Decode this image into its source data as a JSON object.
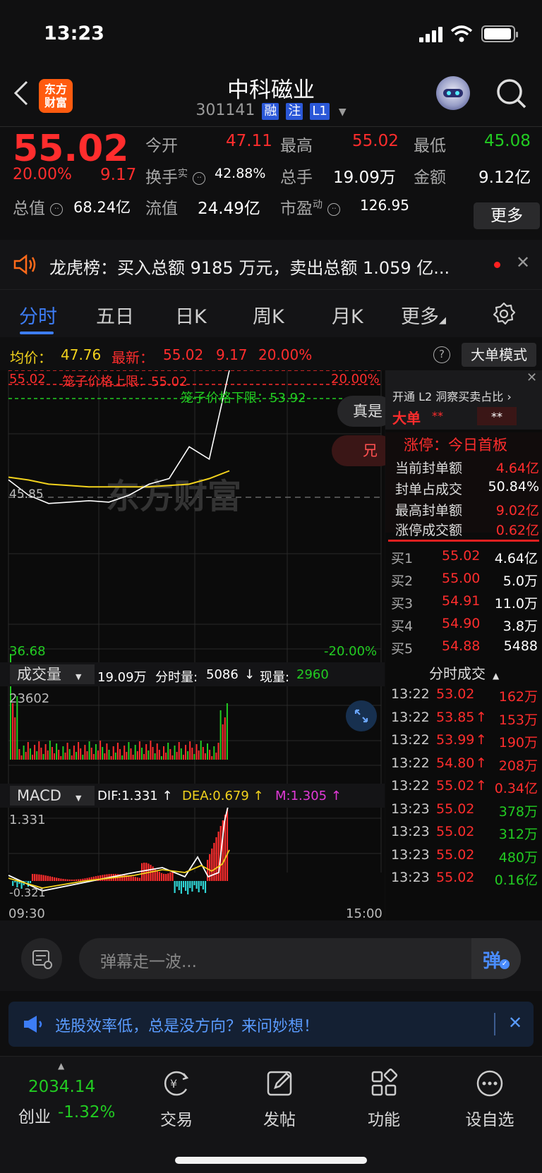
{
  "status_bar": {
    "time": "13:23"
  },
  "header": {
    "stock_name": "中科磁业",
    "stock_code": "301141",
    "tags": [
      "融",
      "注",
      "L1"
    ],
    "logo_text_line1": "东方",
    "logo_text_line2": "财富"
  },
  "quote": {
    "price": "55.02",
    "change_pct": "20.00%",
    "change": "9.17",
    "open_label": "今开",
    "open": "47.11",
    "high_label": "最高",
    "high": "55.02",
    "low_label": "最低",
    "low": "45.08",
    "turnover_label": "换手",
    "turnover_sup": "实",
    "turnover": "42.88%",
    "volume_label": "总手",
    "volume": "19.09万",
    "amount_label": "金额",
    "amount": "9.12亿",
    "mktcap_label": "总值",
    "mktcap": "68.24亿",
    "float_label": "流值",
    "float": "24.49亿",
    "pe_label": "市盈",
    "pe_sup": "动",
    "pe": "126.95",
    "more_label": "更多"
  },
  "dragon": {
    "text": "龙虎榜：买入总额 9185 万元，卖出总额 1.059 亿..."
  },
  "tabs": [
    "分时",
    "五日",
    "日K",
    "周K",
    "月K",
    "更多"
  ],
  "info_line": {
    "avg_label": "均价：",
    "avg": "47.76",
    "latest_label": "最新：",
    "latest": "55.02",
    "latest_change": "9.17",
    "latest_pct": "20.00%",
    "mode_label": "大单模式"
  },
  "chart": {
    "top_price": "55.02",
    "top_pct": "20.00%",
    "bottom_price": "36.68",
    "bottom_pct": "-20.00%",
    "mid_price": "45.85",
    "cage_upper": "笼子价格上限：55.02",
    "cage_lower": "笼子价格下限：53.92",
    "watermark": "东方财富",
    "pill1": "真是",
    "pill2": "兄",
    "volume_label": "成交量",
    "volume_total": "19.09万",
    "vol_detail_label": "分时量:",
    "vol_detail": "5086",
    "vol_now_label": "现量:",
    "vol_now": "2960",
    "vol_max": "23602",
    "macd_label": "MACD",
    "dif": "DIF:1.331 ↑",
    "dea": "DEA:0.679 ↑",
    "m": "M:1.305 ↑",
    "macd_max": "1.331",
    "macd_min": "-0.321",
    "time_start": "09:30",
    "time_end": "15:00"
  },
  "chart_data": {
    "type": "line",
    "x_range": [
      "09:30",
      "15:00"
    ],
    "ylim": [
      36.68,
      55.02
    ],
    "series": [
      {
        "name": "均价",
        "values": [
          47.3,
          47.1,
          46.8,
          46.7,
          46.6,
          46.6,
          46.6,
          46.6,
          46.7,
          46.8,
          47.2,
          47.76
        ]
      },
      {
        "name": "最新",
        "values": [
          47.11,
          46.0,
          45.4,
          45.5,
          45.6,
          45.5,
          46.0,
          46.8,
          47.2,
          49.5,
          48.6,
          55.02
        ]
      }
    ]
  },
  "side": {
    "l2_label": "开通 L2 洞察买卖占比",
    "big_order_label": "大单",
    "big_order_v1": "**",
    "big_order_v2": "**",
    "limit_title": "涨停：今日首板",
    "rows": [
      {
        "label": "当前封单额",
        "value": "4.64亿"
      },
      {
        "label": "封单占成交",
        "value": "50.84%"
      },
      {
        "label": "最高封单额",
        "value": "9.02亿"
      },
      {
        "label": "涨停成交额",
        "value": "0.62亿"
      }
    ],
    "bids": [
      {
        "label": "买1",
        "price": "55.02",
        "vol": "4.64亿"
      },
      {
        "label": "买2",
        "price": "55.00",
        "vol": "5.0万"
      },
      {
        "label": "买3",
        "price": "54.91",
        "vol": "11.0万"
      },
      {
        "label": "买4",
        "price": "54.90",
        "vol": "3.8万"
      },
      {
        "label": "买5",
        "price": "54.88",
        "vol": "5488"
      }
    ],
    "ticks_title": "分时成交",
    "ticks": [
      {
        "time": "13:22",
        "price": "53.02",
        "arrow": "",
        "vol": "162万",
        "color": "red"
      },
      {
        "time": "13:22",
        "price": "53.85",
        "arrow": "↑",
        "vol": "153万",
        "color": "red"
      },
      {
        "time": "13:22",
        "price": "53.99",
        "arrow": "↑",
        "vol": "190万",
        "color": "red"
      },
      {
        "time": "13:22",
        "price": "54.80",
        "arrow": "↑",
        "vol": "208万",
        "color": "red"
      },
      {
        "time": "13:22",
        "price": "55.02",
        "arrow": "↑",
        "vol": "0.34亿",
        "color": "red"
      },
      {
        "time": "13:23",
        "price": "55.02",
        "arrow": "",
        "vol": "378万",
        "color": "green"
      },
      {
        "time": "13:23",
        "price": "55.02",
        "arrow": "",
        "vol": "312万",
        "color": "green"
      },
      {
        "time": "13:23",
        "price": "55.02",
        "arrow": "",
        "vol": "480万",
        "color": "green"
      },
      {
        "time": "13:23",
        "price": "55.02",
        "arrow": "",
        "vol": "0.16亿",
        "color": "green"
      }
    ]
  },
  "comment": {
    "placeholder": "弹幕走一波...",
    "send_icon_text": "弹"
  },
  "ad": {
    "text": "选股效率低，总是没方向？来问妙想！"
  },
  "bottom_nav": {
    "index_value": "2034.14",
    "index_name": "创业",
    "index_change": "-1.32%",
    "items": [
      "交易",
      "发帖",
      "功能",
      "设自选"
    ]
  }
}
